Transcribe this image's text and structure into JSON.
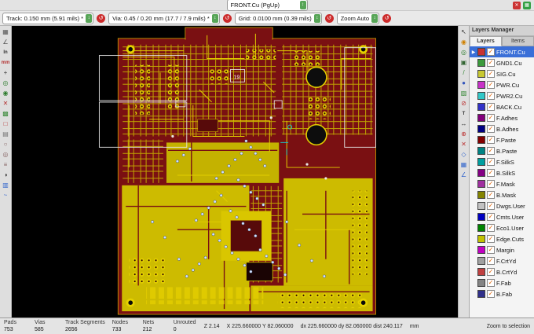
{
  "top_bar": {
    "layer_selector": "FRONT.Cu (PgUp)",
    "buttons": [
      {
        "name": "warning-red-icon",
        "glyph": "✕",
        "color": "#cc3333"
      },
      {
        "name": "drc-green-icon",
        "glyph": "▦",
        "color": "#33a044"
      }
    ]
  },
  "toolbar": {
    "track": "Track: 0.150 mm (5.91 mils) *",
    "via": "Via: 0.45 / 0.20 mm (17.7 / 7.9 mils) *",
    "grid": "Grid: 0.0100 mm (0.39 mils)",
    "zoom": "Zoom Auto"
  },
  "left_toolbar": {
    "icons": [
      {
        "name": "grid-toggle-icon",
        "glyph": "▦",
        "color": "#555555"
      },
      {
        "name": "polar-coords-icon",
        "glyph": "∠",
        "color": "#555555"
      },
      {
        "name": "units-inch-icon",
        "glyph": "In",
        "color": "#333333",
        "txt": true
      },
      {
        "name": "units-mm-icon",
        "glyph": "mm",
        "color": "#b33333",
        "txt": true
      },
      {
        "name": "cursor-shape-icon",
        "glyph": "+",
        "color": "#333333"
      },
      {
        "name": "ratsnest-show-icon",
        "glyph": "◎",
        "color": "#2a7a2a"
      },
      {
        "name": "module-ratsnest-icon",
        "glyph": "◉",
        "color": "#2a7a2a"
      },
      {
        "name": "autodelete-track-icon",
        "glyph": "✕",
        "color": "#b33333"
      },
      {
        "name": "zones-show-icon",
        "glyph": "▩",
        "color": "#3a8a3a"
      },
      {
        "name": "zones-hide-icon",
        "glyph": "□",
        "color": "#b33333"
      },
      {
        "name": "zones-outline-icon",
        "glyph": "▤",
        "color": "#777777"
      },
      {
        "name": "pads-sketch-icon",
        "glyph": "○",
        "color": "#886666"
      },
      {
        "name": "vias-sketch-icon",
        "glyph": "◎",
        "color": "#886666"
      },
      {
        "name": "tracks-sketch-icon",
        "glyph": "≡",
        "color": "#886666"
      },
      {
        "name": "high-contrast-icon",
        "glyph": "◑",
        "color": "#333333"
      },
      {
        "name": "layers-manager-toggle-icon",
        "glyph": "▥",
        "color": "#3366cc"
      },
      {
        "name": "microwave-toolbar-icon",
        "glyph": "~",
        "color": "#3366cc"
      }
    ]
  },
  "right_toolbar": {
    "icons": [
      {
        "name": "select-tool-icon",
        "glyph": "↖",
        "color": "#333333"
      },
      {
        "name": "highlight-net-icon",
        "glyph": "◉",
        "color": "#d08000"
      },
      {
        "name": "local-ratsnest-icon",
        "glyph": "◎",
        "color": "#2a7a2a"
      },
      {
        "name": "add-footprint-icon",
        "glyph": "▣",
        "color": "#336633"
      },
      {
        "name": "route-track-icon",
        "glyph": "/",
        "color": "#3a8a3a"
      },
      {
        "name": "add-via-icon",
        "glyph": "●",
        "color": "#3355bb"
      },
      {
        "name": "add-zone-icon",
        "glyph": "▨",
        "color": "#3a8a3a"
      },
      {
        "name": "add-keepout-icon",
        "glyph": "⊘",
        "color": "#bb3333"
      },
      {
        "name": "add-text-icon",
        "glyph": "T",
        "color": "#333333",
        "txt": true
      },
      {
        "name": "add-dimension-icon",
        "glyph": "↔",
        "color": "#333333"
      },
      {
        "name": "add-target-icon",
        "glyph": "⊕",
        "color": "#bb3333"
      },
      {
        "name": "delete-tool-icon",
        "glyph": "✕",
        "color": "#bb3333"
      },
      {
        "name": "drill-origin-icon",
        "glyph": "◇",
        "color": "#3366cc"
      },
      {
        "name": "grid-origin-icon",
        "glyph": "▦",
        "color": "#3366cc"
      },
      {
        "name": "measure-icon",
        "glyph": "∠",
        "color": "#3366cc"
      }
    ]
  },
  "layers_manager": {
    "title": "Layers Manager",
    "tabs": [
      "Layers",
      "Items"
    ],
    "active_tab": "Layers",
    "indicator_glyph": "▶",
    "check_glyph": "✓",
    "layers": [
      {
        "name": "FRONT.Cu",
        "color": "#c83232",
        "checked": true,
        "selected": true
      },
      {
        "name": "GND1.Cu",
        "color": "#3c9b3c",
        "checked": true,
        "selected": false
      },
      {
        "name": "SIG.Cu",
        "color": "#c8c832",
        "checked": true,
        "selected": false
      },
      {
        "name": "PWR.Cu",
        "color": "#c832c8",
        "checked": true,
        "selected": false
      },
      {
        "name": "PWR2.Cu",
        "color": "#32c8c8",
        "checked": true,
        "selected": false
      },
      {
        "name": "BACK.Cu",
        "color": "#3232c8",
        "checked": true,
        "selected": false
      },
      {
        "name": "F.Adhes",
        "color": "#84007d",
        "checked": true,
        "selected": false
      },
      {
        "name": "B.Adhes",
        "color": "#000084",
        "checked": true,
        "selected": false
      },
      {
        "name": "F.Paste",
        "color": "#840000",
        "checked": true,
        "selected": false
      },
      {
        "name": "B.Paste",
        "color": "#008484",
        "checked": true,
        "selected": false
      },
      {
        "name": "F.SilkS",
        "color": "#00a0a0",
        "checked": true,
        "selected": false
      },
      {
        "name": "B.SilkS",
        "color": "#840084",
        "checked": true,
        "selected": false
      },
      {
        "name": "F.Mask",
        "color": "#a030a0",
        "checked": true,
        "selected": false
      },
      {
        "name": "B.Mask",
        "color": "#848400",
        "checked": true,
        "selected": false
      },
      {
        "name": "Dwgs.User",
        "color": "#c2c2c2",
        "checked": true,
        "selected": false
      },
      {
        "name": "Cmts.User",
        "color": "#0000c2",
        "checked": true,
        "selected": false
      },
      {
        "name": "Eco1.User",
        "color": "#008400",
        "checked": true,
        "selected": false
      },
      {
        "name": "Edge.Cuts",
        "color": "#c2c200",
        "checked": true,
        "selected": false
      },
      {
        "name": "Margin",
        "color": "#c200c2",
        "checked": true,
        "selected": false
      },
      {
        "name": "F.CrtYd",
        "color": "#a0a0a0",
        "checked": true,
        "selected": false
      },
      {
        "name": "B.CrtYd",
        "color": "#c04040",
        "checked": true,
        "selected": false
      },
      {
        "name": "F.Fab",
        "color": "#848484",
        "checked": true,
        "selected": false
      },
      {
        "name": "B.Fab",
        "color": "#30308a",
        "checked": true,
        "selected": false
      }
    ]
  },
  "canvas": {
    "component_label": "19"
  },
  "status_bar": {
    "stats": [
      {
        "label": "Pads",
        "value": "753"
      },
      {
        "label": "Vias",
        "value": "585"
      },
      {
        "label": "Track Segments",
        "value": "2656"
      },
      {
        "label": "Nodes",
        "value": "733"
      },
      {
        "label": "Nets",
        "value": "212"
      },
      {
        "label": "Unrouted",
        "value": "0"
      }
    ],
    "zoom_level": "Z 2.14",
    "cursor_position": "X 225.660000 Y 82.060000",
    "relative_position": "dx 225.660000 dy 82.060000 dist 240.117",
    "units": "mm",
    "message": "Zoom to selection"
  }
}
